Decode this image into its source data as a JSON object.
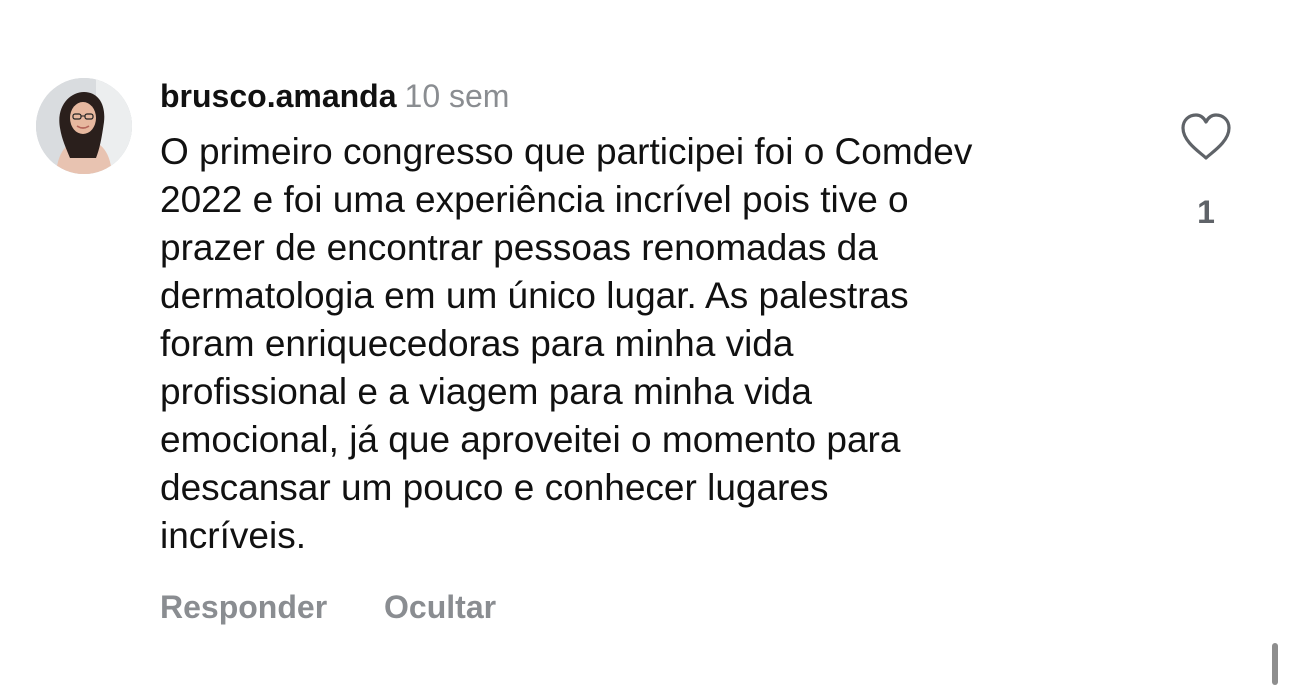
{
  "comment": {
    "username": "brusco.amanda",
    "timestamp": "10 sem",
    "text_lines": [
      "O primeiro congresso que participei foi o Comdev",
      "2022 e foi uma experiência incrível pois tive o",
      "prazer de encontrar pessoas renomadas da",
      "dermatologia em um único lugar. As palestras",
      "foram enriquecedoras para minha vida",
      "profissional e a viagem para minha vida",
      "emocional, já que aproveitei o momento para",
      "descansar um pouco e conhecer lugares",
      "incríveis."
    ],
    "like_icon": "heart-outline-icon",
    "like_count": "1"
  },
  "actions": {
    "reply_label": "Responder",
    "hide_label": "Ocultar"
  },
  "colors": {
    "text": "#111111",
    "secondary": "#8a8d91",
    "like_count": "#5f6368",
    "background": "#ffffff"
  }
}
